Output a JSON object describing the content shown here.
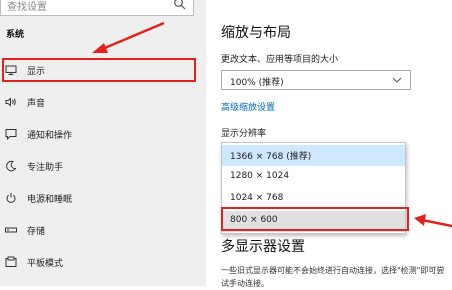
{
  "sidebar": {
    "search_placeholder": "查找设置",
    "section_title": "系统",
    "items": [
      {
        "label": "显示",
        "icon": "monitor-icon"
      },
      {
        "label": "声音",
        "icon": "speaker-icon"
      },
      {
        "label": "通知和操作",
        "icon": "message-icon"
      },
      {
        "label": "专注助手",
        "icon": "moon-icon"
      },
      {
        "label": "电源和睡眠",
        "icon": "power-icon"
      },
      {
        "label": "存储",
        "icon": "storage-icon"
      },
      {
        "label": "平板模式",
        "icon": "tablet-icon"
      }
    ]
  },
  "main": {
    "title": "缩放与布局",
    "scale_label": "更改文本、应用等项目的大小",
    "scale_value": "100% (推荐)",
    "advanced_link": "高级缩放设置",
    "resolution_label": "显示分辨率",
    "resolution_options": [
      "1366 × 768 (推荐)",
      "1280 × 1024",
      "1024 × 768",
      "800 × 600"
    ],
    "multi_display_title": "多显示器设置",
    "multi_display_text": "一些旧式显示器可能不会始终进行自动连接，选择\"检测\"即可尝试手动连接。"
  },
  "colors": {
    "accent_link": "#0067b8",
    "annotation_red": "#e0231c",
    "selected_option": "#cde8ff"
  }
}
